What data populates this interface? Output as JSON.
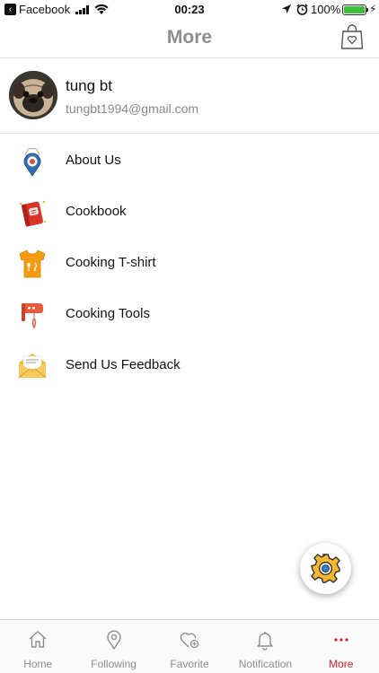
{
  "status_bar": {
    "back_app": "Facebook",
    "time": "00:23",
    "battery_percent": "100%",
    "battery_level": 1.0,
    "battery_color": "#3cc13b"
  },
  "header": {
    "title": "More",
    "cart_icon": "shopping-bag-heart-icon"
  },
  "profile": {
    "name": "tung bt",
    "email": "tungbt1994@gmail.com"
  },
  "menu": {
    "items": [
      {
        "label": "About Us",
        "icon": "chef-location-icon"
      },
      {
        "label": "Cookbook",
        "icon": "cookbook-icon"
      },
      {
        "label": "Cooking T-shirt",
        "icon": "tshirt-icon"
      },
      {
        "label": "Cooking Tools",
        "icon": "mixer-icon"
      },
      {
        "label": "Send Us Feedback",
        "icon": "envelope-icon"
      }
    ]
  },
  "fab": {
    "icon": "gear-icon"
  },
  "tabbar": {
    "active_color": "#e02020",
    "tabs": [
      {
        "label": "Home",
        "icon": "home-icon"
      },
      {
        "label": "Following",
        "icon": "location-pin-icon"
      },
      {
        "label": "Favorite",
        "icon": "heart-plus-icon"
      },
      {
        "label": "Notification",
        "icon": "bell-icon"
      },
      {
        "label": "More",
        "icon": "more-dots-icon",
        "active": true
      }
    ]
  }
}
